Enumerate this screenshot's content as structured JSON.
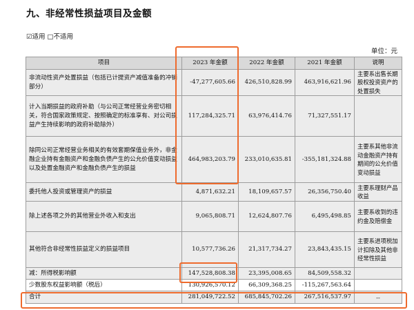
{
  "heading": "九、非经常性损益项目及金额",
  "applicable": "☑适用 □不适用",
  "unit": "单位：元",
  "table": {
    "headers": [
      "项目",
      "2023 年金额",
      "2022 年金额",
      "2021 年金额",
      "说明"
    ],
    "rows": [
      {
        "item": "非流动性资产处置损益（包括已计提资产减值准备的冲销部分）",
        "y2023": "-47,277,605.66",
        "y2022": "426,510,828.99",
        "y2021": "463,916,621.96",
        "note": "主要系出售长期股权投资资产的处置损失"
      },
      {
        "item": "计入当期损益的政府补助（与公司正常经营业务密切相关，符合国家政策规定、按照确定的标准享有、对公司损益产生持续影响的政府补助除外）",
        "y2023": "117,284,325.71",
        "y2022": "63,976,414.76",
        "y2021": "71,327,551.17",
        "note": ""
      },
      {
        "item": "除同公司正常经营业务相关的有效套期保值业务外，非金融企业持有金融资产和金融负债产生的公允价值变动损益以及处置金融资产和金融负债产生的损益",
        "y2023": "464,983,203.79",
        "y2022": "233,010,635.81",
        "y2021": "-355,181,324.88",
        "note": "主要系其他非流动金融资产持有期间的公允价值变动损益"
      },
      {
        "item": "委托他人投资或管理资产的损益",
        "y2023": "4,871,632.21",
        "y2022": "18,109,657.57",
        "y2021": "26,356,750.40",
        "note": "主要系理财产品收益"
      },
      {
        "item": "除上述各项之外的其他营业外收入和支出",
        "y2023": "9,065,808.71",
        "y2022": "12,624,807.76",
        "y2021": "6,495,498.85",
        "note": "主要系收到的违约金及赔偿金"
      },
      {
        "item": "其他符合非经常性损益定义的损益项目",
        "y2023": "10,577,736.26",
        "y2022": "21,317,734.27",
        "y2021": "23,843,435.15",
        "note": "主要系进项税加计扣除及其他非经常性损益"
      },
      {
        "item": "减：所得税影响额",
        "y2023": "147,528,808.38",
        "y2022": "23,395,008.65",
        "y2021": "84,509,558.32",
        "note": ""
      },
      {
        "item": "少数股东权益影响额（税后）",
        "y2023": "130,926,570.12",
        "y2022": "66,309,368.25",
        "y2021": "-115,267,563.64",
        "note": ""
      },
      {
        "item": "合计",
        "y2023": "281,049,722.52",
        "y2022": "685,845,702.26",
        "y2021": "267,516,537.97",
        "note": "--"
      }
    ]
  },
  "colors": {
    "highlight": "#ee6a2c",
    "header_bg": "#d9d9d9",
    "row_bg": "#ececec"
  }
}
